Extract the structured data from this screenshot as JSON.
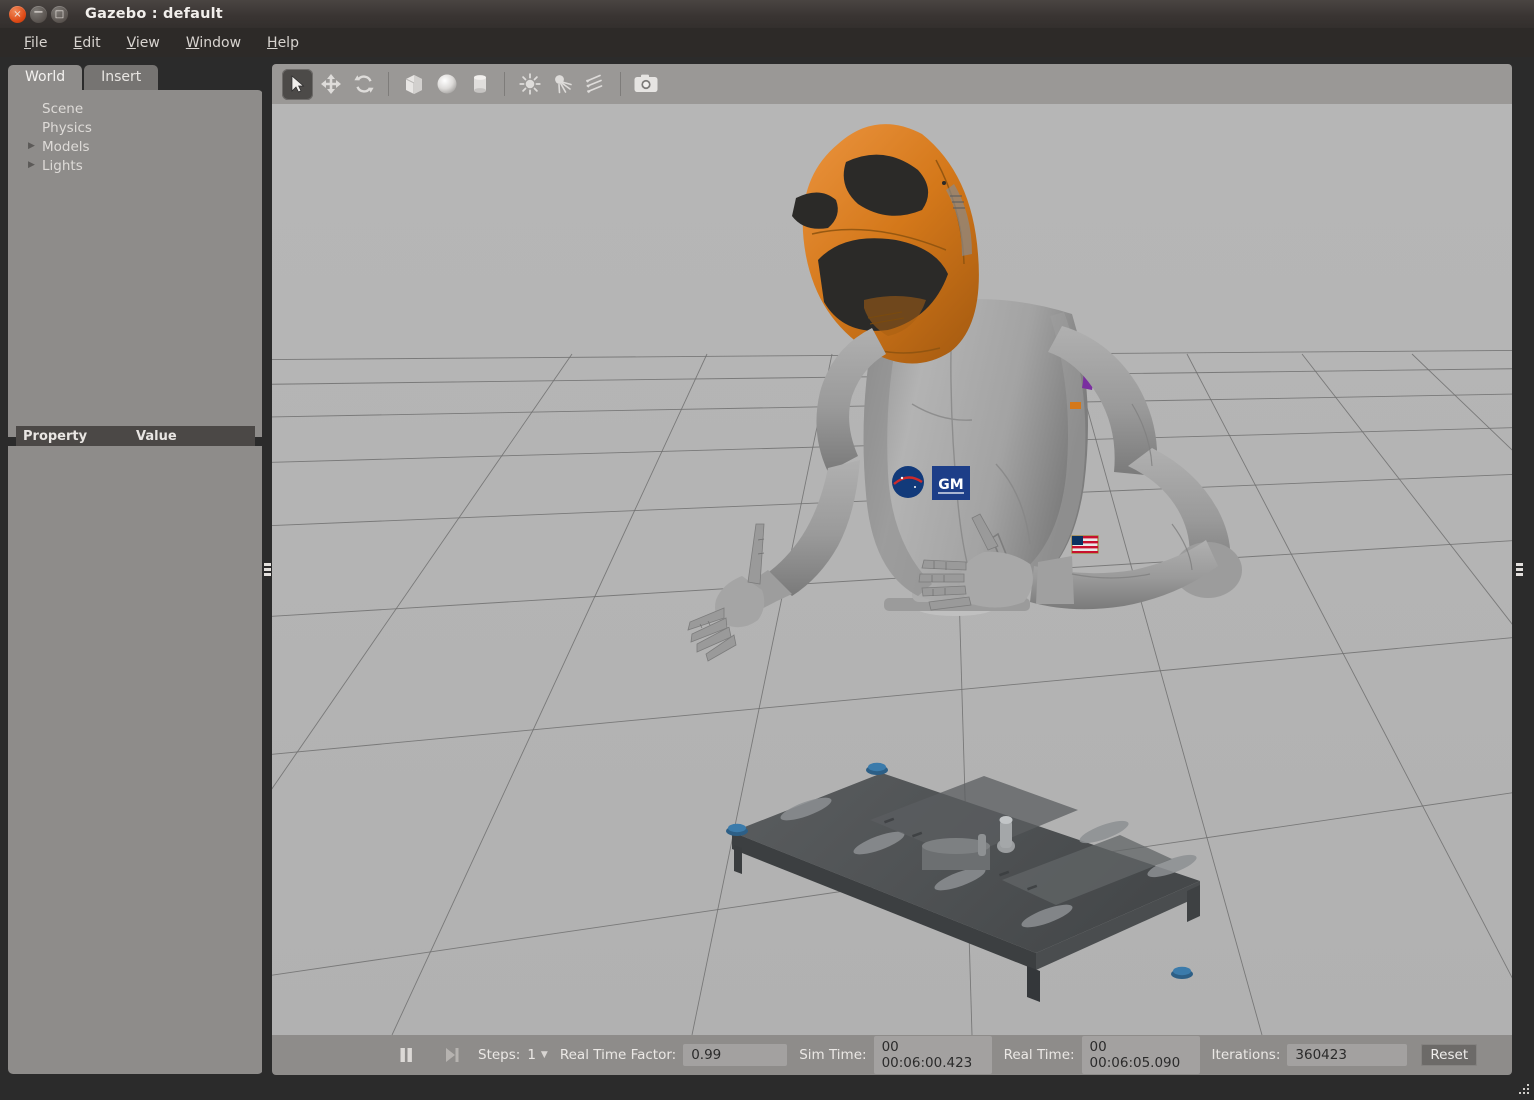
{
  "window": {
    "title": "Gazebo : default",
    "buttons": [
      {
        "name": "close",
        "glyph": "×"
      },
      {
        "name": "minimize",
        "glyph": "−"
      },
      {
        "name": "maximize",
        "glyph": "□"
      }
    ]
  },
  "menubar": {
    "items": [
      {
        "accel": "F",
        "rest": "ile"
      },
      {
        "accel": "E",
        "rest": "dit"
      },
      {
        "accel": "V",
        "rest": "iew"
      },
      {
        "accel": "W",
        "rest": "indow"
      },
      {
        "accel": "H",
        "rest": "elp"
      }
    ]
  },
  "left_panel": {
    "tabs": [
      {
        "label": "World",
        "active": true
      },
      {
        "label": "Insert",
        "active": false
      }
    ],
    "tree": [
      {
        "label": "Scene",
        "expandable": false,
        "expanded": false
      },
      {
        "label": "Physics",
        "expandable": false,
        "expanded": false
      },
      {
        "label": "Models",
        "expandable": true,
        "expanded": false
      },
      {
        "label": "Lights",
        "expandable": true,
        "expanded": false
      }
    ],
    "property_table": {
      "columns": [
        "Property",
        "Value"
      ],
      "rows": []
    }
  },
  "view_toolbar": {
    "buttons": [
      {
        "name": "select-mode",
        "icon": "cursor-arrow-icon",
        "active": true
      },
      {
        "name": "translate-mode",
        "icon": "move-arrows-icon",
        "active": false
      },
      {
        "name": "rotate-mode",
        "icon": "rotate-arrows-icon",
        "active": false
      },
      {
        "name": "insert-box",
        "icon": "box-icon",
        "active": false
      },
      {
        "name": "insert-sphere",
        "icon": "sphere-icon",
        "active": false
      },
      {
        "name": "insert-cylinder",
        "icon": "cylinder-icon",
        "active": false
      },
      {
        "name": "insert-point-light",
        "icon": "point-light-icon",
        "active": false
      },
      {
        "name": "insert-spot-light",
        "icon": "spot-light-icon",
        "active": false
      },
      {
        "name": "insert-directional-light",
        "icon": "directional-light-icon",
        "active": false
      },
      {
        "name": "screenshot",
        "icon": "camera-icon",
        "active": false
      }
    ]
  },
  "playbar": {
    "pause_icon": "pause-icon",
    "step_icon": "step-forward-icon",
    "steps_label": "Steps:",
    "steps_value": "1",
    "real_time_factor_label": "Real Time Factor:",
    "real_time_factor_value": "0.99",
    "sim_time_label": "Sim Time:",
    "sim_time_value": "00 00:06:00.423",
    "real_time_label": "Real Time:",
    "real_time_value": "00 00:06:05.090",
    "iterations_label": "Iterations:",
    "iterations_value": "360423",
    "reset_label": "Reset"
  },
  "scene": {
    "model_name": "Robonaut 2 (R2)",
    "ground_color": "#b4b4b4",
    "grid_line_color": "#6e6e6e",
    "helmet_color": "#d4781a",
    "body_color": "#9e9e9e",
    "base_color": "#4e5153",
    "bolt_color": "#2d5f86",
    "logos": [
      "NASA",
      "GM",
      "US flag"
    ]
  },
  "colors": {
    "accent": "#dd4814",
    "panel_bg": "#8e8c8a",
    "toolbar_bg": "#9a9896",
    "titlebar_bg": "#3a3533",
    "menu_bg": "#2d2a28"
  }
}
